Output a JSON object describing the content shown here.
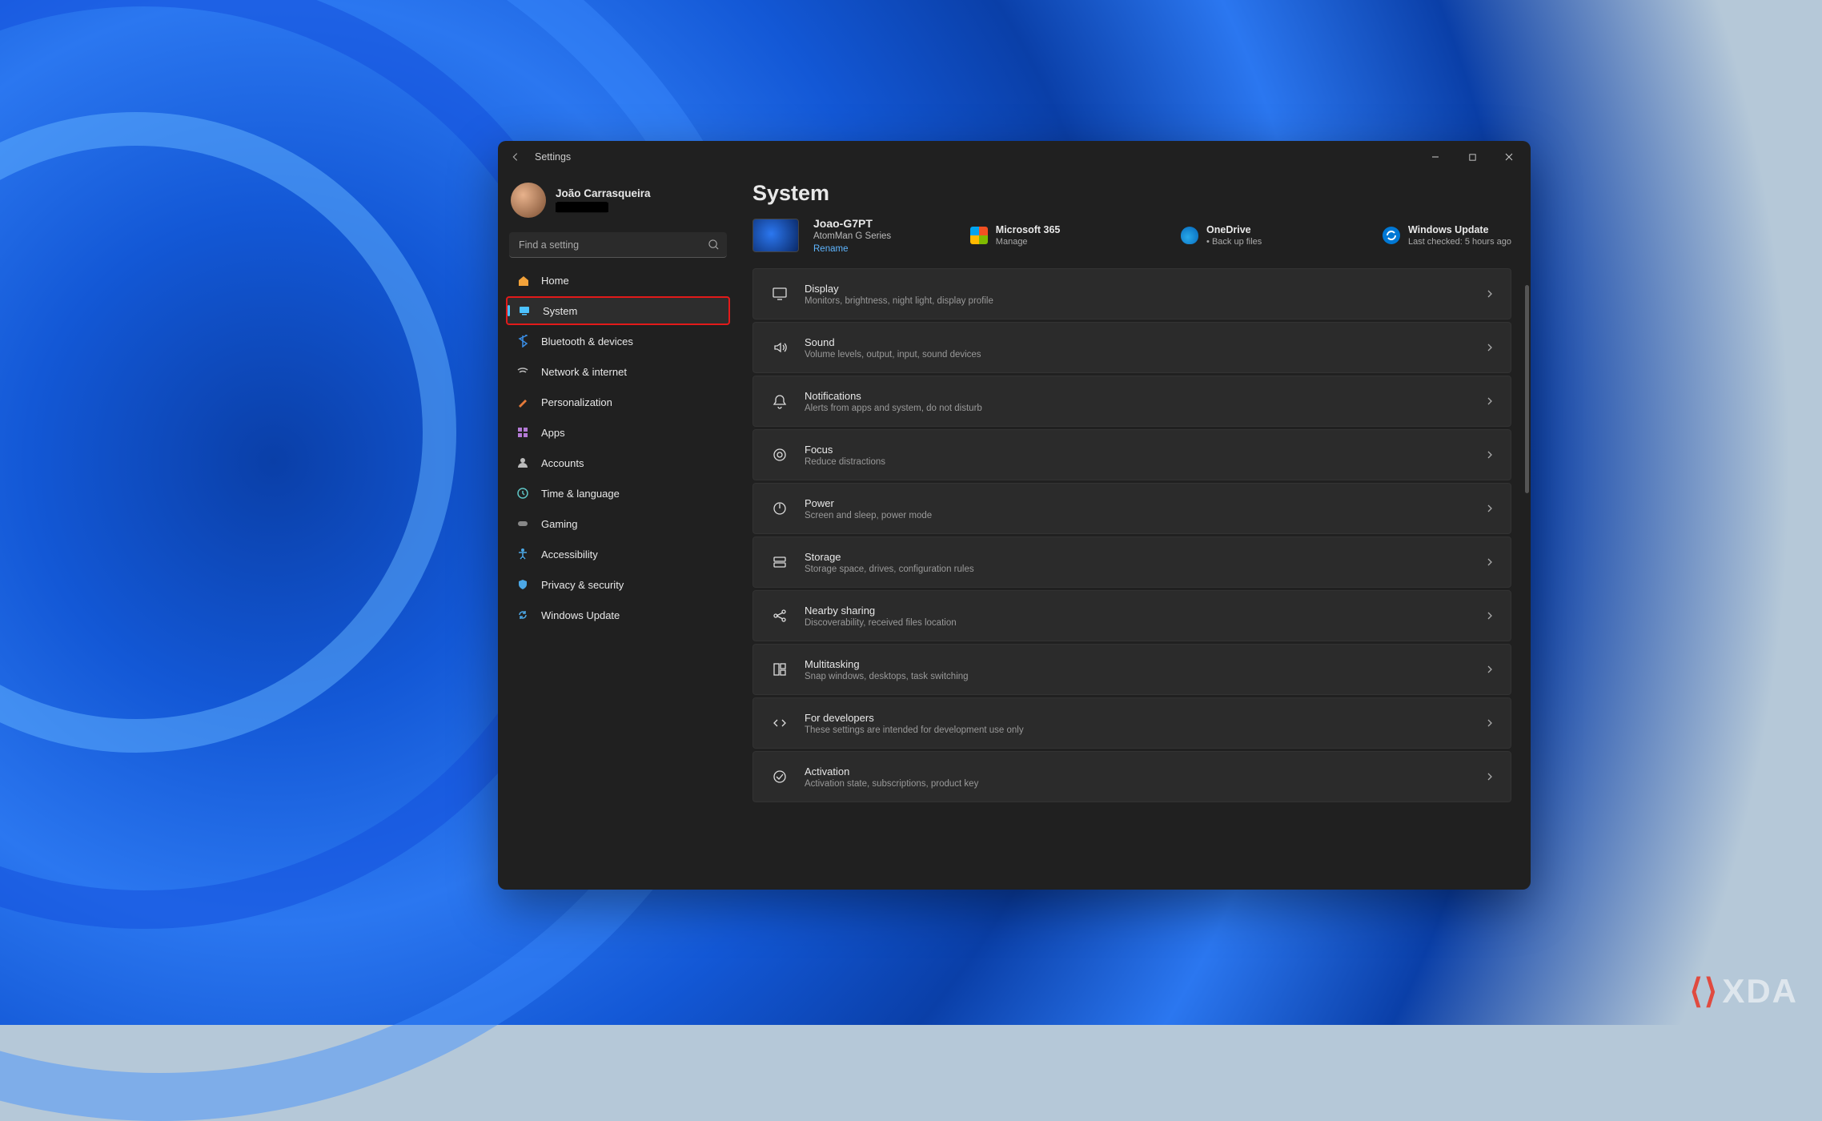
{
  "app": {
    "title": "Settings"
  },
  "user": {
    "name": "João Carrasqueira",
    "email_hidden": "████████"
  },
  "search": {
    "placeholder": "Find a setting"
  },
  "sidebar": {
    "items": [
      {
        "id": "home",
        "label": "Home",
        "icon": "home",
        "color": "#f2a23a"
      },
      {
        "id": "system",
        "label": "System",
        "icon": "system",
        "color": "#4cc2ff",
        "selected": true,
        "highlight": true
      },
      {
        "id": "bluetooth",
        "label": "Bluetooth & devices",
        "icon": "bluetooth",
        "color": "#3a8ee6"
      },
      {
        "id": "network",
        "label": "Network & internet",
        "icon": "wifi",
        "color": "#bbb"
      },
      {
        "id": "personalization",
        "label": "Personalization",
        "icon": "brush",
        "color": "#e67a3a"
      },
      {
        "id": "apps",
        "label": "Apps",
        "icon": "apps",
        "color": "#b47ad6"
      },
      {
        "id": "accounts",
        "label": "Accounts",
        "icon": "account",
        "color": "#bbb"
      },
      {
        "id": "time",
        "label": "Time & language",
        "icon": "clock",
        "color": "#5ec4c4"
      },
      {
        "id": "gaming",
        "label": "Gaming",
        "icon": "gamepad",
        "color": "#888"
      },
      {
        "id": "accessibility",
        "label": "Accessibility",
        "icon": "accessibility",
        "color": "#4ca8e6"
      },
      {
        "id": "privacy",
        "label": "Privacy & security",
        "icon": "shield",
        "color": "#4ca8e6"
      },
      {
        "id": "update",
        "label": "Windows Update",
        "icon": "update",
        "color": "#4ca8e6"
      }
    ]
  },
  "page": {
    "title": "System",
    "device": {
      "name": "Joao-G7PT",
      "model": "AtomMan G Series",
      "rename": "Rename"
    },
    "status": [
      {
        "id": "m365",
        "title": "Microsoft 365",
        "sub": "Manage"
      },
      {
        "id": "onedrive",
        "title": "OneDrive",
        "sub": "• Back up files"
      },
      {
        "id": "update",
        "title": "Windows Update",
        "sub": "Last checked: 5 hours ago"
      }
    ],
    "cards": [
      {
        "id": "display",
        "title": "Display",
        "sub": "Monitors, brightness, night light, display profile",
        "icon": "display"
      },
      {
        "id": "sound",
        "title": "Sound",
        "sub": "Volume levels, output, input, sound devices",
        "icon": "sound"
      },
      {
        "id": "notifications",
        "title": "Notifications",
        "sub": "Alerts from apps and system, do not disturb",
        "icon": "bell"
      },
      {
        "id": "focus",
        "title": "Focus",
        "sub": "Reduce distractions",
        "icon": "focus"
      },
      {
        "id": "power",
        "title": "Power",
        "sub": "Screen and sleep, power mode",
        "icon": "power",
        "highlight": true
      },
      {
        "id": "storage",
        "title": "Storage",
        "sub": "Storage space, drives, configuration rules",
        "icon": "storage"
      },
      {
        "id": "nearby",
        "title": "Nearby sharing",
        "sub": "Discoverability, received files location",
        "icon": "share"
      },
      {
        "id": "multitask",
        "title": "Multitasking",
        "sub": "Snap windows, desktops, task switching",
        "icon": "multitask"
      },
      {
        "id": "developers",
        "title": "For developers",
        "sub": "These settings are intended for development use only",
        "icon": "dev"
      },
      {
        "id": "activation",
        "title": "Activation",
        "sub": "Activation state, subscriptions, product key",
        "icon": "check"
      }
    ]
  },
  "watermark": "XDA"
}
